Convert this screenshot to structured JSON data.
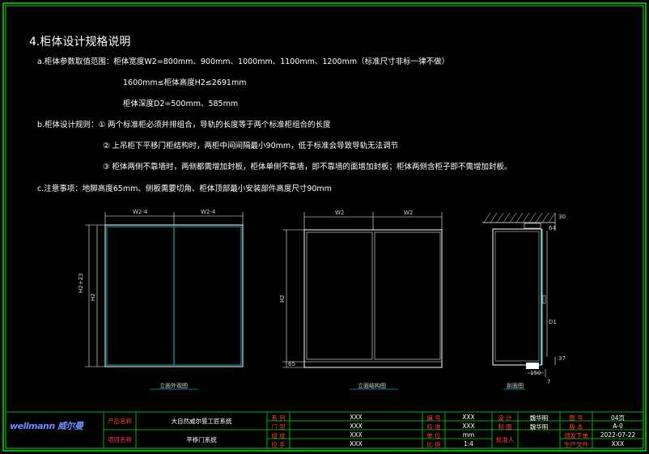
{
  "title": "4.柜体设计规格说明",
  "spec_a": {
    "line1": "a.柜体参数取值范围：柜体宽度W2=800mm、900mm、1000mm、1100mm、1200mm（标准尺寸非标一律不做）",
    "line2": "1600mm≤柜体高度H2≤2691mm",
    "line3": "柜体深度D2=500mm、585mm"
  },
  "spec_b": {
    "line1": "b.柜体设计规则：① 两个标准柜必须并排组合，导轨的长度等于两个标准柜组合的长度",
    "line2": "② 上吊柜下平移门柜结构时，两柜中间间隔最小90mm，低于标准会导致导轨无法调节",
    "line3": "③ 柜体两侧不靠墙时，两侧都需增加封板，柜体单侧不靠墙，即不靠墙的面增加封板；柜体两侧含柜子即不需增加封板。"
  },
  "spec_c": {
    "line1": "c.注意事项：地脚高度65mm、侧板需要切角、柜体顶部最小安装部件高度尺寸90mm"
  },
  "drawing1": {
    "dim_left": "W2-4",
    "dim_right": "W2-4",
    "dim_height_outer": "H2+23",
    "dim_height_inner": "H2",
    "caption": "立面外观图"
  },
  "drawing2": {
    "dim_left": "W2",
    "dim_right": "W2",
    "dim_height": "H2",
    "dim_base": "65",
    "caption": "立面结构图"
  },
  "drawing3": {
    "dim_top": "30",
    "dim_top2": "64",
    "dim_side": "D1",
    "dim_bottom": "37",
    "dim_depth": "150",
    "dim_foot": "7",
    "caption": "剖面图"
  },
  "title_block": {
    "logo": "wellmann 威尔曼",
    "product_name_label": "产品名称",
    "product_name_value": "大自然威尔曼工匠系统",
    "project_name_label": "项目名称",
    "project_name_value": "平移门系统",
    "rows_left": [
      {
        "label": "系  列",
        "value": "XXX"
      },
      {
        "label": "门  型",
        "value": "XXX"
      },
      {
        "label": "组  成",
        "value": "XXX"
      },
      {
        "label": "拉  手",
        "value": "XXX"
      }
    ],
    "rows_mid": [
      {
        "label": "编  号",
        "value": "XXX"
      },
      {
        "label": "标  准",
        "value": "XXX"
      },
      {
        "label": "单  位",
        "value": "mm"
      },
      {
        "label": "比  例",
        "value": "1:4"
      }
    ],
    "designer_label": "设  计",
    "designer_value": "魏华明",
    "drafter_label": "制  图",
    "drafter_value": "魏华明",
    "checker_label": "批准人",
    "checker_value": "",
    "page_label": "图  号",
    "page_value": "04页",
    "version_label": "版  本",
    "version_value": "A-0",
    "release_label": "颁发下单",
    "release_value": "2022-07-22",
    "production_label": "生产文件",
    "production_value": "XXX"
  },
  "colors": {
    "background": "#000000",
    "frame": "#00e000",
    "line": "#ffffff",
    "cabinet_inner": "#00d8d8",
    "label_red": "#ff3b3b",
    "label_blue": "#6f8dff"
  }
}
